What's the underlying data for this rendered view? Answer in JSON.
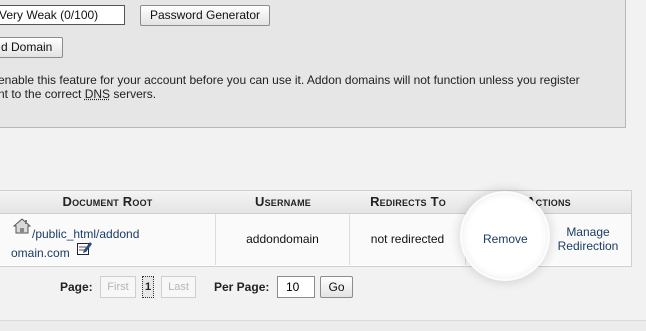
{
  "password": {
    "strength_text": "Very Weak (0/100)",
    "generator_label": "Password Generator"
  },
  "add_domain": {
    "button_label": "d Domain"
  },
  "notice": {
    "line1": "enable this feature for your account before you can use it. Addon domains will not function unless you register",
    "line2_pre": "nt to the correct ",
    "line2_dns": "DNS",
    "line2_post": " servers."
  },
  "table": {
    "headers": {
      "document_root": "Document Root",
      "username": "Username",
      "redirects_to": "Redirects To",
      "actions": "Actions"
    },
    "row": {
      "docroot_line1": "/public_html/addond",
      "docroot_line2": "omain.com",
      "username": "addondomain",
      "redirects": "not redirected",
      "remove": "Remove",
      "manage_line1": "Manage",
      "manage_line2": "Redirection"
    }
  },
  "pagination": {
    "page_label": "Page:",
    "first": "First",
    "current": "1",
    "last": "Last",
    "per_page_label": "Per Page:",
    "per_page_value": "10",
    "go": "Go"
  },
  "icons": [
    "home-icon",
    "edit-icon"
  ]
}
